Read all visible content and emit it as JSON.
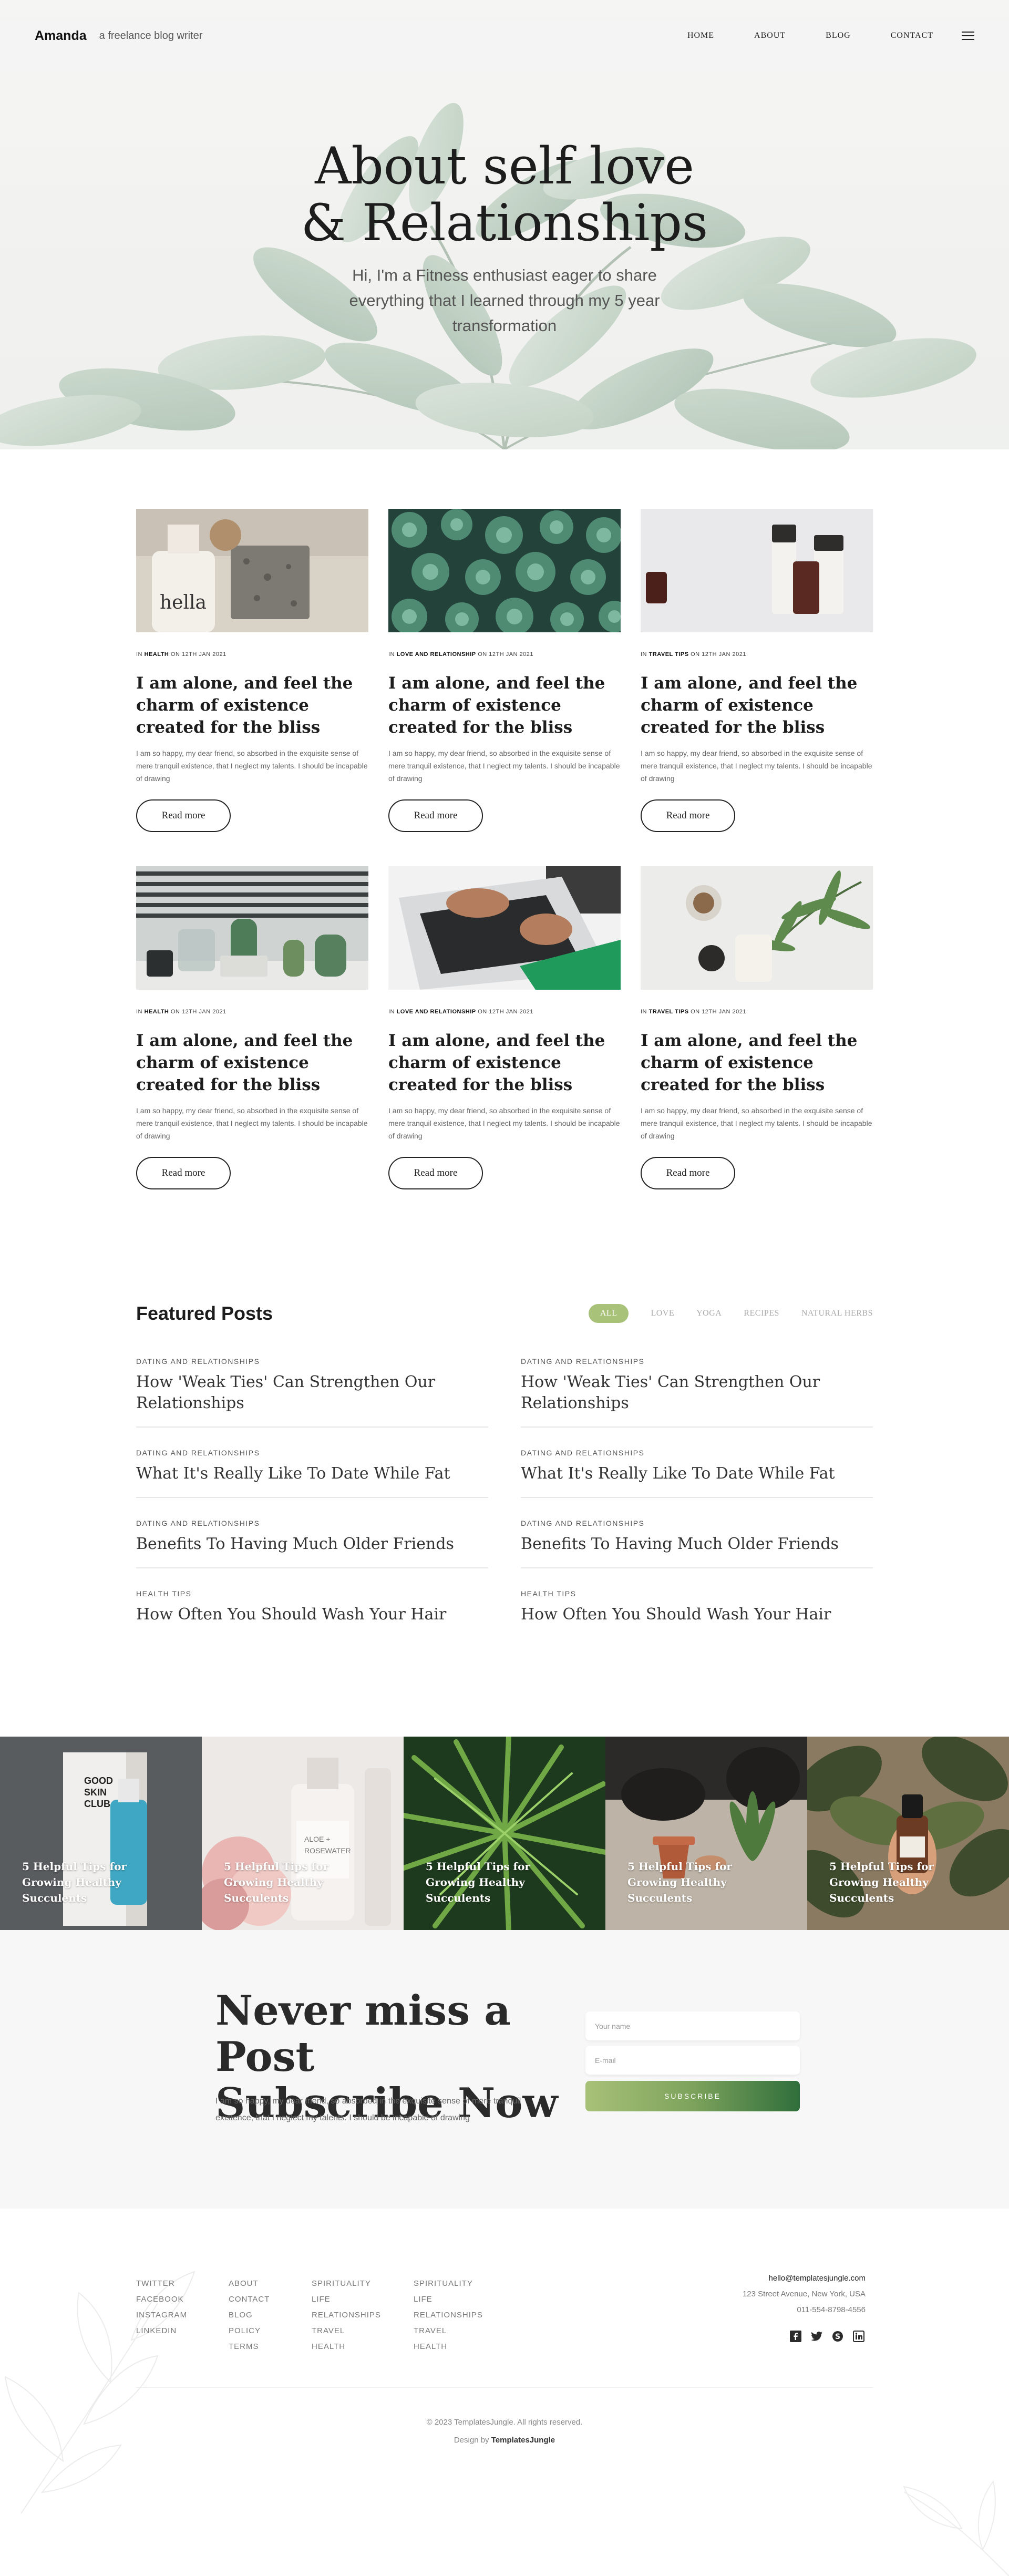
{
  "header": {
    "brand": "Amanda",
    "tagline": "a freelance blog writer",
    "nav": [
      "HOME",
      "ABOUT",
      "BLOG",
      "CONTACT"
    ]
  },
  "hero": {
    "title_line1": "About self love",
    "title_line2": "& Relationships",
    "subtitle": "Hi, I'm a Fitness enthusiast eager to share everything that I learned through my 5 year transformation"
  },
  "posts": [
    {
      "prefix": "IN",
      "category": "HEALTH",
      "date": "ON 12TH JAN 2021",
      "title": "I am alone, and feel the charm of existence created for the bliss",
      "excerpt": "I am so happy, my dear friend, so absorbed in the exquisite sense of mere tranquil existence, that I neglect my talents. I should be incapable of drawing",
      "button": "Read more",
      "image_icon": "cosmetics-photo"
    },
    {
      "prefix": "IN",
      "category": "LOVE AND RELATIONSHIP",
      "date": "ON 12TH JAN 2021",
      "title": "I am alone, and feel the charm of existence created for the bliss",
      "excerpt": "I am so happy, my dear friend, so absorbed in the exquisite sense of mere tranquil existence, that I neglect my talents. I should be incapable of drawing",
      "button": "Read more",
      "image_icon": "succulents-photo"
    },
    {
      "prefix": "IN",
      "category": "TRAVEL TIPS",
      "date": "ON 12TH JAN 2021",
      "title": "I am alone, and feel the charm of existence created for the bliss",
      "excerpt": "I am so happy, my dear friend, so absorbed in the exquisite sense of mere tranquil existence, that I neglect my talents. I should be incapable of drawing",
      "button": "Read more",
      "image_icon": "skincare-bottles-photo"
    },
    {
      "prefix": "IN",
      "category": "HEALTH",
      "date": "ON 12TH JAN 2021",
      "title": "I am alone, and feel the charm of existence created for the bliss",
      "excerpt": "I am so happy, my dear friend, so absorbed in the exquisite sense of mere tranquil existence, that I neglect my talents. I should be incapable of drawing",
      "button": "Read more",
      "image_icon": "cactus-window-photo"
    },
    {
      "prefix": "IN",
      "category": "LOVE AND RELATIONSHIP",
      "date": "ON 12TH JAN 2021",
      "title": "I am alone, and feel the charm of existence created for the bliss",
      "excerpt": "I am so happy, my dear friend, so absorbed in the exquisite sense of mere tranquil existence, that I neglect my talents. I should be incapable of drawing",
      "button": "Read more",
      "image_icon": "laptop-typing-photo"
    },
    {
      "prefix": "IN",
      "category": "TRAVEL TIPS",
      "date": "ON 12TH JAN 2021",
      "title": "I am alone, and feel the charm of existence created for the bliss",
      "excerpt": "I am so happy, my dear friend, so absorbed in the exquisite sense of mere tranquil existence, that I neglect my talents. I should be incapable of drawing",
      "button": "Read more",
      "image_icon": "leaf-cosmetics-photo"
    }
  ],
  "featured": {
    "title": "Featured Posts",
    "filters": [
      "ALL",
      "LOVE",
      "YOGA",
      "RECIPES",
      "NATURAL HERBS"
    ],
    "active_filter": "ALL",
    "accent": "#a9c27a",
    "items": [
      {
        "category": "DATING AND RELATIONSHIPS",
        "title": "How 'Weak Ties' Can Strengthen Our Relationships"
      },
      {
        "category": "DATING AND RELATIONSHIPS",
        "title": "How 'Weak Ties' Can Strengthen Our Relationships"
      },
      {
        "category": "DATING AND RELATIONSHIPS",
        "title": "What It's Really Like To Date While Fat"
      },
      {
        "category": "DATING AND RELATIONSHIPS",
        "title": "What It's Really Like To Date While Fat"
      },
      {
        "category": "DATING AND RELATIONSHIPS",
        "title": "Benefits To Having Much Older Friends"
      },
      {
        "category": "DATING AND RELATIONSHIPS",
        "title": "Benefits To Having Much Older Friends"
      },
      {
        "category": "HEALTH TIPS",
        "title": "How Often You Should Wash Your Hair"
      },
      {
        "category": "HEALTH TIPS",
        "title": "How Often You Should Wash Your Hair"
      }
    ]
  },
  "gallery": [
    {
      "caption": "5 Helpful Tips for Growing Healthy Succulents",
      "image_icon": "serum-box-photo"
    },
    {
      "caption": "5 Helpful Tips for Growing Healthy Succulents",
      "image_icon": "aloe-bottle-photo"
    },
    {
      "caption": "5 Helpful Tips for Growing Healthy Succulents",
      "image_icon": "palm-leaves-photo"
    },
    {
      "caption": "5 Helpful Tips for Growing Healthy Succulents",
      "image_icon": "gardening-photo"
    },
    {
      "caption": "5 Helpful Tips for Growing Healthy Succulents",
      "image_icon": "dropper-bottle-photo"
    }
  ],
  "subscribe": {
    "title_line1": "Never miss a Post",
    "title_line2": "Subscribe Now",
    "text": "I am so happy, my dear friend, so absorbed in the exquisite sense of mere tranquil existence, that I neglect my talents. I should be incapable of drawing",
    "name_placeholder": "Your name",
    "email_placeholder": "E-mail",
    "button": "SUBSCRIBE"
  },
  "footer": {
    "col1": [
      "TWITTER",
      "FACEBOOK",
      "INSTAGRAM",
      "LINKEDIN"
    ],
    "col2": [
      "ABOUT",
      "CONTACT",
      "BLOG",
      "POLICY",
      "TERMS"
    ],
    "col3": [
      "SPIRITUALITY",
      "LIFE",
      "RELATIONSHIPS",
      "TRAVEL",
      "HEALTH"
    ],
    "col4": [
      "SPIRITUALITY",
      "LIFE",
      "RELATIONSHIPS",
      "TRAVEL",
      "HEALTH"
    ],
    "email": "hello@templatesjungle.com",
    "address": "123 Street Avenue, New York, USA",
    "phone": "011-554-8798-4556",
    "social_icons": [
      "facebook-icon",
      "twitter-icon",
      "skype-icon",
      "linkedin-icon"
    ],
    "copyright": "© 2023 TemplatesJungle. All rights reserved.",
    "design_prefix": "Design by",
    "design_by": "TemplatesJungle"
  }
}
